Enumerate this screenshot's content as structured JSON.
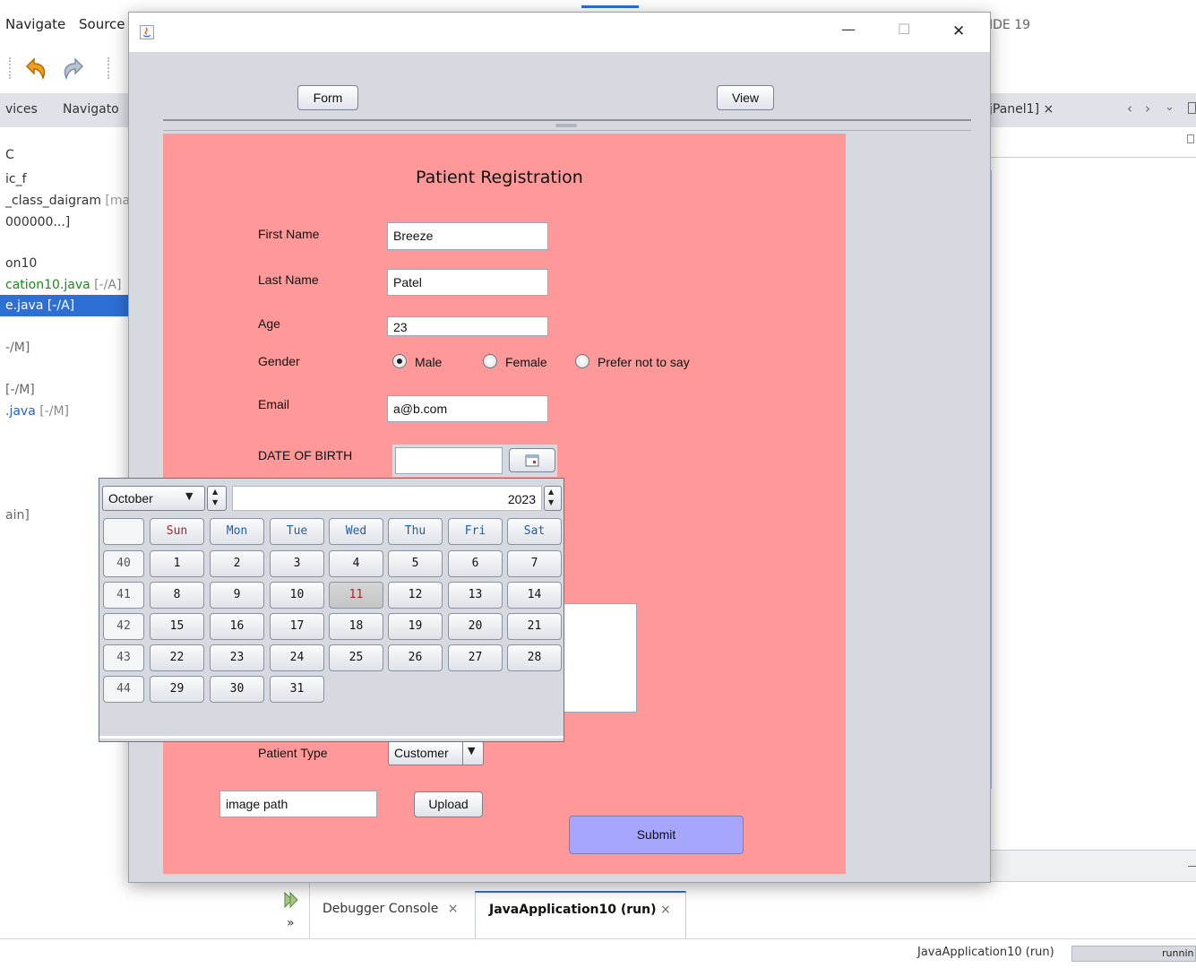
{
  "ide": {
    "menu": [
      "Navigate",
      "Source"
    ],
    "title_suffix": "IDE 19",
    "tabs": [
      "vices",
      "Navigato"
    ],
    "right_tab": "jPanel1]",
    "tree": [
      {
        "text": "C",
        "color": "#333333"
      },
      {
        "text": "ic_f",
        "color": "#333333"
      },
      {
        "text": "_class_daigram",
        "extra": "[ma",
        "color": "#333333"
      },
      {
        "text": "000000...]",
        "color": "#333333"
      },
      {
        "text": "on10",
        "color": "#333333"
      },
      {
        "text": "cation10.java",
        "extra": "[-/A]",
        "color": "#1a8a1a"
      },
      {
        "text": "e.java [-/A]",
        "color": "#ffffff",
        "selected": true
      },
      {
        "text": "-/M]",
        "color": "#666666"
      },
      {
        "text": "[-/M]",
        "color": "#666666"
      },
      {
        "text": ".java",
        "extra": "[-/M]",
        "color": "#1f5fd6"
      },
      {
        "text": "ain]",
        "color": "#666666"
      }
    ],
    "console_tabs": [
      {
        "label": "Debugger Console",
        "active": false
      },
      {
        "label": "JavaApplication10 (run)",
        "active": true
      }
    ],
    "console_chevron": "»",
    "status_text": "JavaApplication10 (run)",
    "status_progress": "runnin",
    "close_glyph": "×"
  },
  "window": {
    "minimize": "—",
    "maximize": "☐",
    "close": "✕",
    "form_button": "Form",
    "view_button": "View"
  },
  "form": {
    "title": "Patient Registration",
    "first_name_label": "First Name",
    "first_name_value": "Breeze",
    "last_name_label": "Last Name",
    "last_name_value": "Patel",
    "age_label": "Age",
    "age_value": "23",
    "gender_label": "Gender",
    "gender_options": [
      {
        "label": "Male",
        "selected": true
      },
      {
        "label": "Female",
        "selected": false
      },
      {
        "label": "Prefer not to say",
        "selected": false
      }
    ],
    "email_label": "Email",
    "email_value": "a@b.com",
    "dob_label": "DATE OF BIRTH",
    "dob_value": "",
    "patient_type_label": "Patient Type",
    "patient_type_value": "Customer",
    "image_path_value": "image path",
    "upload_button": "Upload",
    "submit_button": "Submit",
    "submit_color": "#a6a6ff",
    "panel_color": "#ff9999"
  },
  "calendar": {
    "month": "October",
    "year": "2023",
    "day_headers": [
      "Sun",
      "Mon",
      "Tue",
      "Wed",
      "Thu",
      "Fri",
      "Sat"
    ],
    "weeks": [
      {
        "week": "40",
        "days": [
          "1",
          "2",
          "3",
          "4",
          "5",
          "6",
          "7"
        ]
      },
      {
        "week": "41",
        "days": [
          "8",
          "9",
          "10",
          "11",
          "12",
          "13",
          "14"
        ]
      },
      {
        "week": "42",
        "days": [
          "15",
          "16",
          "17",
          "18",
          "19",
          "20",
          "21"
        ]
      },
      {
        "week": "43",
        "days": [
          "22",
          "23",
          "24",
          "25",
          "26",
          "27",
          "28"
        ]
      },
      {
        "week": "44",
        "days": [
          "29",
          "30",
          "31"
        ]
      }
    ],
    "today": "11"
  }
}
